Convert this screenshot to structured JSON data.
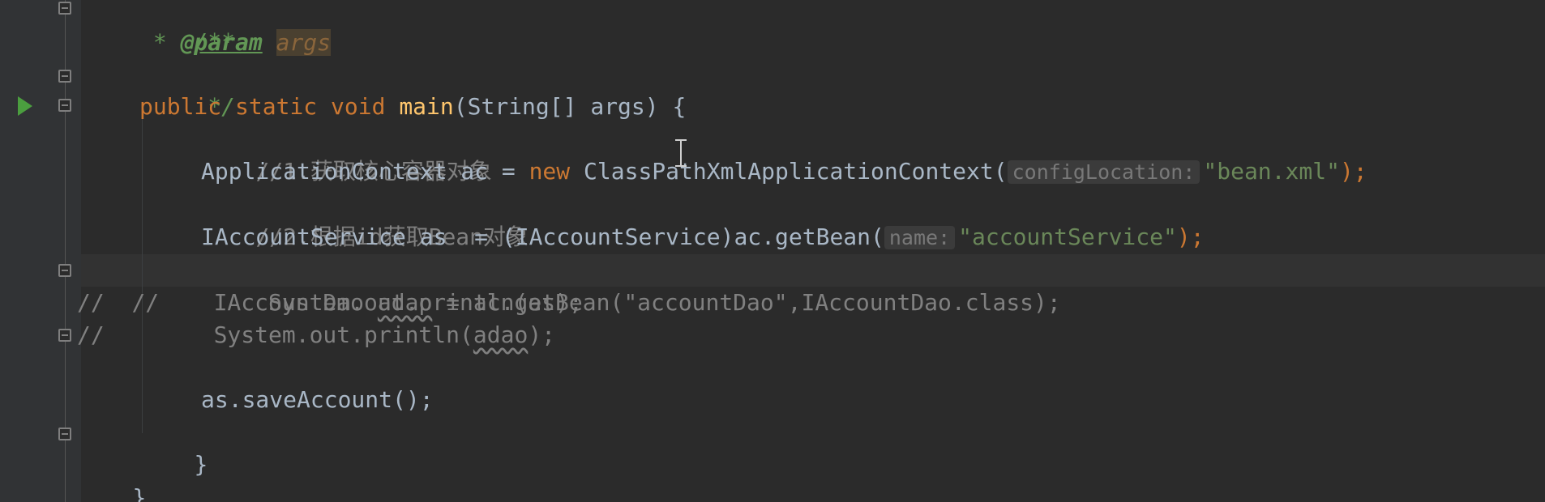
{
  "editor": {
    "language": "Java",
    "lines": {
      "l1": "/**",
      "l2_star": " * ",
      "l2_tag": "@param",
      "l2_param": "args",
      "l3": " */",
      "l4": {
        "kw1": "public",
        "kw2": "static",
        "kw3": "void",
        "fn": "main",
        "rest": "(String[] args) {"
      },
      "l5": "//1.获取核心容器对象",
      "l6": {
        "a": "ApplicationContext ac = ",
        "kw": "new",
        "b": " ClassPathXmlApplicationContext(",
        "hint": "configLocation:",
        "str": "\"bean.xml\"",
        "c": ");"
      },
      "l7": "//2.根据id获取Bean对象",
      "l8": {
        "a": "IAccountService as  = (IAccountService)ac.getBean(",
        "hint": "name:",
        "str": "\"accountService\"",
        "c": ");"
      },
      "l9": "//        System.out.println(as);",
      "l10": {
        "a": "//        IAccountDao ",
        "sq": "adao",
        "b": " = ac.getBean(\"accountDao\",IAccountDao.class);"
      },
      "l11": {
        "a": "//        System.out.println(",
        "sq": "adao",
        "b": ");"
      },
      "l13": "as.saveAccount();",
      "l14": "}",
      "l15": "}"
    }
  },
  "colors": {
    "background": "#2b2b2b",
    "gutter": "#313335",
    "keyword": "#cc7832",
    "function": "#ffc66d",
    "string": "#6a8759",
    "comment": "#808080",
    "javadoc": "#629755"
  },
  "icons": {
    "run": "run-gutter-icon",
    "fold": "fold-marker-icon"
  }
}
